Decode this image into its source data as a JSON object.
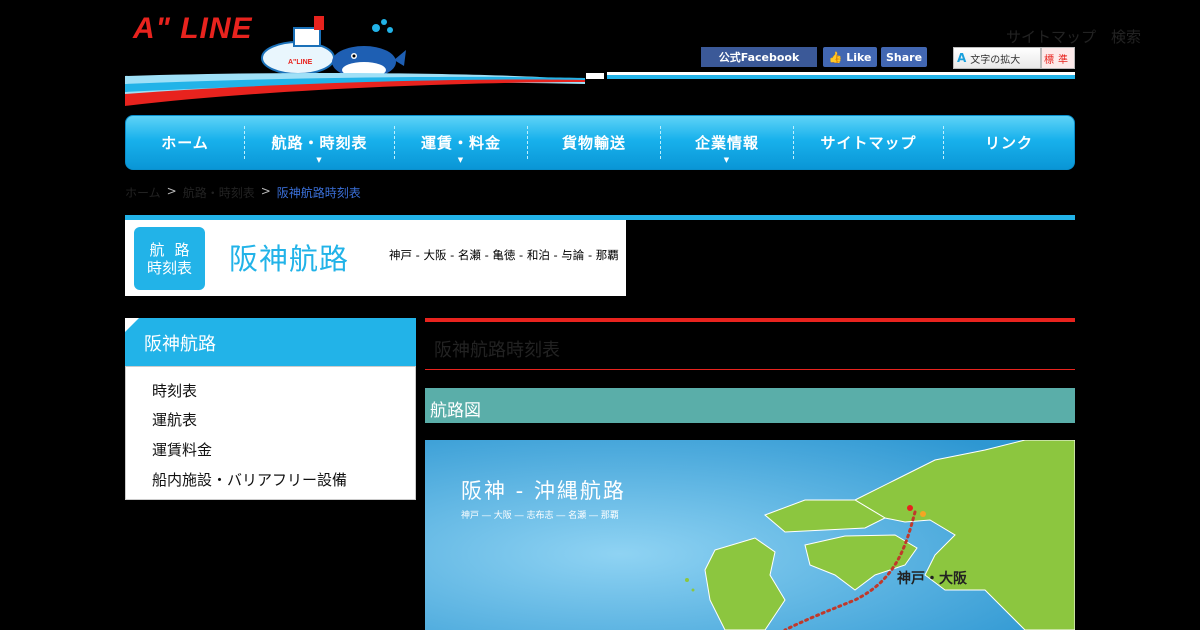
{
  "header": {
    "logo": "A\" LINE",
    "util_text": "サイトマップ　検索",
    "fb_official": "公式Facebook",
    "fb_like": "Like",
    "fb_share": "Share",
    "font_size_label": "文字の拡大",
    "font_size_standard": "標準"
  },
  "nav": {
    "items": [
      {
        "label": "ホーム"
      },
      {
        "label": "航路・時刻表"
      },
      {
        "label": "運賃・料金"
      },
      {
        "label": "貨物輸送"
      },
      {
        "label": "企業情報"
      },
      {
        "label": "サイトマップ"
      },
      {
        "label": "リンク"
      }
    ]
  },
  "breadcrumb": {
    "items": [
      "ホーム",
      "航路・時刻表"
    ],
    "current": "阪神航路時刻表"
  },
  "route_banner": {
    "badge_line1": "航路",
    "badge_line2": "時刻表",
    "title": "阪神航路",
    "stops": "神戸 - 大阪 - 名瀬 - 亀徳 - 和泊 - 与論 - 那覇"
  },
  "sidebar": {
    "title": "阪神航路",
    "links": [
      "時刻表",
      "運航表",
      "運賃料金",
      "船内施設・バリアフリー設備"
    ]
  },
  "main": {
    "page_title": "阪神航路時刻表",
    "section_title": "航路図"
  },
  "map": {
    "title": "阪神 - 沖縄航路",
    "subtitle": "神戸 ― 大阪 ― 志布志 ― 名瀬 ― 那覇",
    "label_kobe_osaka": "神戸・大阪"
  },
  "colors": {
    "accent": "#22b3e8",
    "brand_red": "#e8231e",
    "section": "#5aaea9",
    "sea": "#3aa3d8",
    "land": "#8cc63f"
  }
}
